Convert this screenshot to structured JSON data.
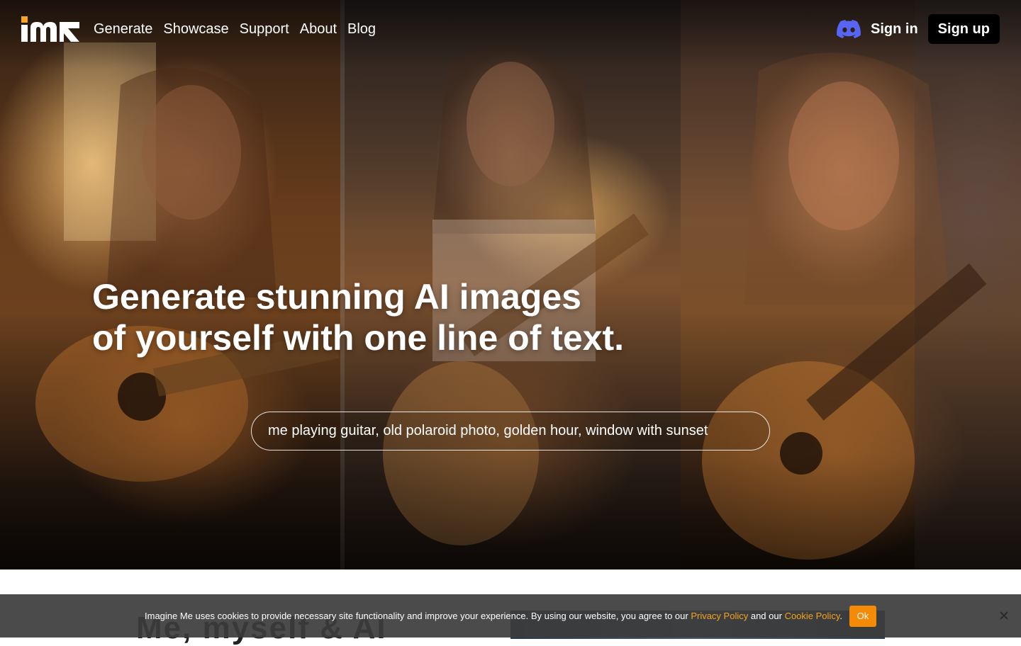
{
  "nav": {
    "links": [
      "Generate",
      "Showcase",
      "Support",
      "About",
      "Blog"
    ],
    "sign_in": "Sign in",
    "sign_up": "Sign up"
  },
  "hero": {
    "headline_line1": "Generate stunning AI images",
    "headline_line2": "of yourself with one line of text.",
    "prompt_example": "me playing guitar, old polaroid photo, golden hour, window with sunset"
  },
  "section": {
    "title": "Me, myself & AI"
  },
  "cookie": {
    "text_before": "Imagine Me uses cookies to provide necessary site functionality and improve your experience. By using our website, you agree to our ",
    "privacy_link": "Privacy Policy",
    "text_middle": " and our ",
    "cookie_link": "Cookie Policy",
    "text_after": ".",
    "ok_label": "Ok"
  },
  "colors": {
    "accent": "#f5a623",
    "discord": "#5865f2",
    "ok_button": "#f58a07"
  },
  "icons": {
    "discord": "discord-icon",
    "close": "close-icon"
  }
}
